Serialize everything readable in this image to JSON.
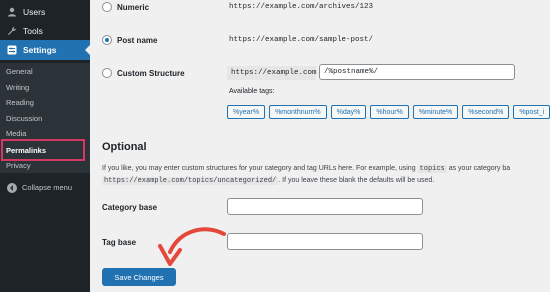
{
  "sidebar": {
    "top_items": [
      {
        "label": "Users",
        "icon": "users-icon"
      },
      {
        "label": "Tools",
        "icon": "wrench-icon"
      },
      {
        "label": "Settings",
        "icon": "settings-icon"
      }
    ],
    "submenu": [
      "General",
      "Writing",
      "Reading",
      "Discussion",
      "Media",
      "Permalinks",
      "Privacy"
    ],
    "collapse_label": "Collapse menu",
    "accent_color": "#2271b1",
    "highlight_color": "#d63864"
  },
  "permalink_options": {
    "numeric": {
      "label": "Numeric",
      "example": "https://example.com/archives/123"
    },
    "post_name": {
      "label": "Post name",
      "example": "https://example.com/sample-post/"
    },
    "custom": {
      "label": "Custom Structure",
      "prefix": "https://example.com",
      "value": "/%postname%/"
    }
  },
  "available_tags_label": "Available tags:",
  "tags": [
    "%year%",
    "%monthnum%",
    "%day%",
    "%hour%",
    "%minute%",
    "%second%",
    "%post_i"
  ],
  "optional": {
    "title": "Optional",
    "help_line1_a": "If you like, you may enter custom structures for your category and tag URLs here. For example, using",
    "help_code1": "topics",
    "help_line1_b": "as your category ba",
    "help_code2": "https://example.com/topics/uncategorized/",
    "help_line2_b": ". If you leave these blank the defaults will be used."
  },
  "fields": {
    "category_base_label": "Category base",
    "tag_base_label": "Tag base"
  },
  "save_label": "Save Changes"
}
